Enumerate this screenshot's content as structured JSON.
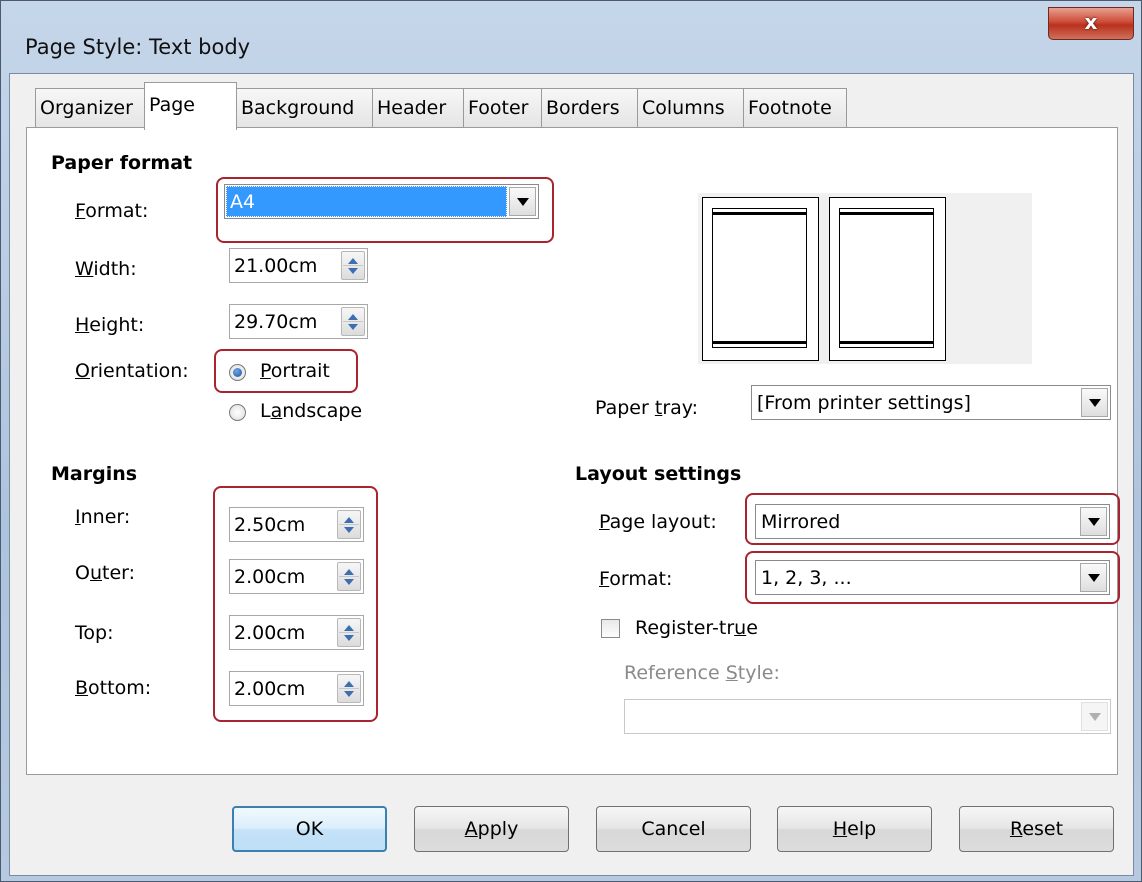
{
  "window": {
    "title": "Page Style: Text body",
    "close_glyph": "x"
  },
  "tabs": [
    "Organizer",
    "Page",
    "Background",
    "Header",
    "Footer",
    "Borders",
    "Columns",
    "Footnote"
  ],
  "active_tab": "Page",
  "paper_format": {
    "heading": "Paper format",
    "format": {
      "label": "Format:",
      "value": "A4"
    },
    "width": {
      "label": "Width:",
      "value": "21.00cm"
    },
    "height": {
      "label": "Height:",
      "value": "29.70cm"
    },
    "orientation": {
      "label": "Orientation:",
      "portrait": "Portrait",
      "landscape": "Landscape",
      "selected": "Portrait"
    },
    "paper_tray": {
      "label": "Paper tray:",
      "value": "[From printer settings]"
    }
  },
  "margins": {
    "heading": "Margins",
    "inner": {
      "label": "Inner:",
      "value": "2.50cm"
    },
    "outer": {
      "label": "Outer:",
      "value": "2.00cm"
    },
    "top": {
      "label": "Top:",
      "value": "2.00cm"
    },
    "bottom": {
      "label": "Bottom:",
      "value": "2.00cm"
    }
  },
  "layout": {
    "heading": "Layout settings",
    "page_layout": {
      "label": "Page layout:",
      "value": "Mirrored"
    },
    "format": {
      "label": "Format:",
      "value": "1, 2, 3, ..."
    },
    "register_true": {
      "label": "Register-true",
      "checked": false
    },
    "reference_style": {
      "label": "Reference Style:",
      "value": ""
    }
  },
  "buttons": {
    "ok": "OK",
    "apply": "Apply",
    "cancel": "Cancel",
    "help": "Help",
    "reset": "Reset"
  },
  "colors": {
    "highlight": "#a8242e",
    "selection": "#3399ff",
    "close": "#c9462f"
  }
}
